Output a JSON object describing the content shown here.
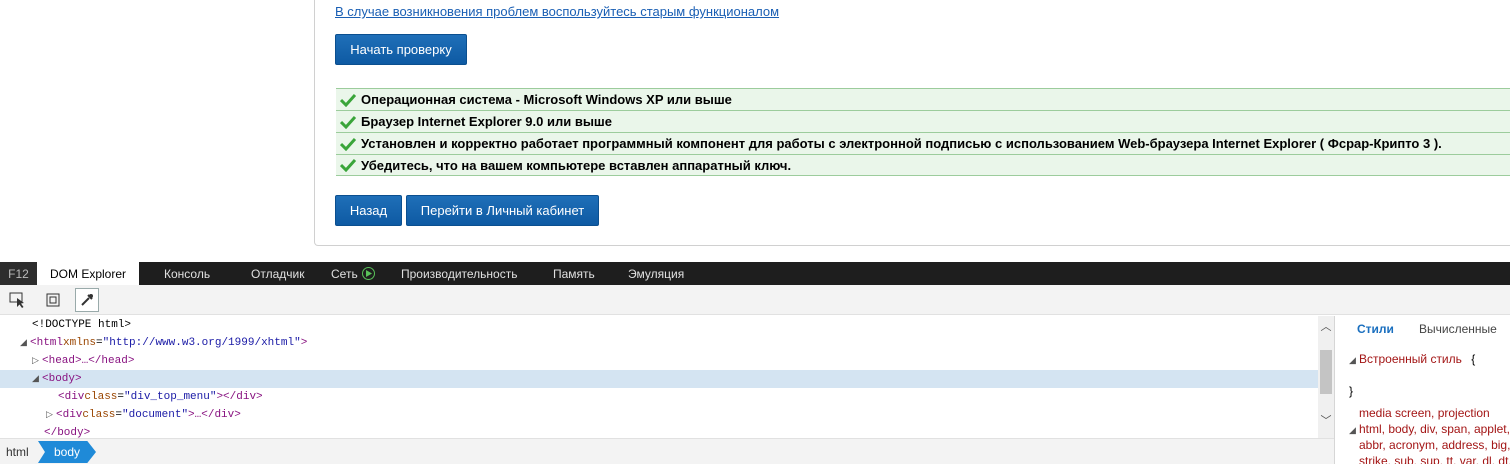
{
  "page": {
    "old_link": "В случае возникновения проблем воспользуйтесь старым функционалом",
    "start_button": "Начать проверку",
    "checks": [
      "Операционная система - Microsoft Windows XP или выше",
      "Браузер Internet Explorer 9.0 или выше",
      "Установлен и корректно работает программный компонент для работы с электронной подписью с использованием Web-браузера Internet Explorer ( Фсрар-Крипто 3 ).",
      "Убедитесь, что на вашем компьютере вставлен аппаратный ключ."
    ],
    "back_button": "Назад",
    "cabinet_button": "Перейти в Личный кабинет"
  },
  "devtools": {
    "tabs": {
      "f12": "F12",
      "dom": "DOM Explorer",
      "console": "Консоль",
      "debugger": "Отладчик",
      "network": "Сеть",
      "performance": "Производительность",
      "memory": "Память",
      "emulation": "Эмуляция"
    },
    "tree": {
      "doctype": "<!DOCTYPE html>",
      "html_open": "<html",
      "html_attr": "xmlns",
      "html_attr_val": "\"http://www.w3.org/1999/xhtml\"",
      "html_close": ">",
      "head": "<head>…</head>",
      "body_open": "<body>",
      "div1_open": "<div",
      "div1_attr": "class",
      "div1_val": "\"div_top_menu\"",
      "div1_close": "></div>",
      "div2_open": "<div",
      "div2_attr": "class",
      "div2_val": "\"document\"",
      "div2_close": ">…</div>",
      "body_close": "</body>"
    },
    "breadcrumb": [
      "html",
      "body"
    ],
    "styles": {
      "tab_styles": "Стили",
      "tab_computed": "Вычисленные",
      "inline_style": "Встроенный стиль",
      "brace_open": "{",
      "brace_close": "}",
      "media": "media screen, projection",
      "selector1": "html, body, div, span, applet,",
      "selector2": "abbr, acronym, address, big,",
      "selector3": "strike, sub, sup, tt, var, dl, dt,"
    }
  },
  "colors": {
    "accent": "#1f6fb8",
    "check_bg": "#eaf6ea",
    "check_icon": "#3aa53a",
    "devtools_bar": "#1e1e1e",
    "selection": "#d4e4f2"
  }
}
